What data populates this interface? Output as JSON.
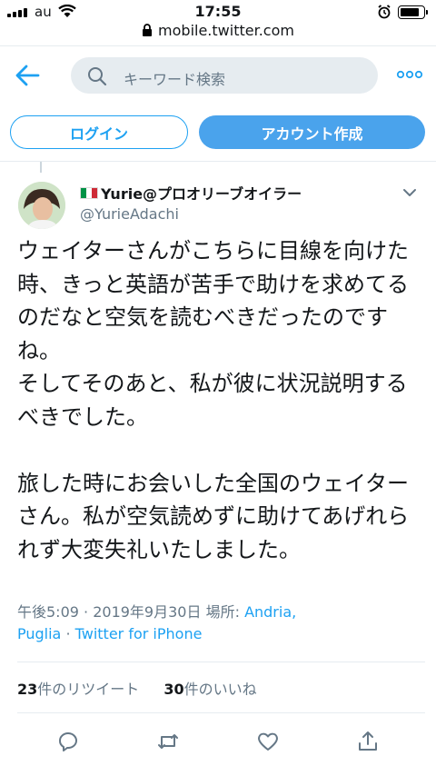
{
  "status_bar": {
    "carrier": "au",
    "time": "17:55",
    "battery_level": 0.85
  },
  "browser": {
    "url": "mobile.twitter.com"
  },
  "header": {
    "search_placeholder": "キーワード検索"
  },
  "auth": {
    "login_label": "ログイン",
    "signup_label": "アカウント作成"
  },
  "tweet": {
    "display_name": "Yurie@プロオリーブオイラー",
    "handle": "@YurieAdachi",
    "text": "ウェイターさんがこちらに目線を向けた時、きっと英語が苦手で助けを求めてるのだなと空気を読むべきだったのですね。\nそしてそのあと、私が彼に状況説明するべきでした。\n\n旅した時にお会いした全国のウェイターさん。私が空気読めずに助けてあげれられず大変失礼いたしました。",
    "time": "午後5:09",
    "date": "2019年9月30日",
    "location_label": "場所:",
    "location_line1": "Andria,",
    "location_line2": "Puglia",
    "source": "Twitter for iPhone"
  },
  "stats": {
    "retweets_count": "23",
    "retweets_label": "件のリツイート",
    "likes_count": "30",
    "likes_label": "件のいいね"
  },
  "icons": {
    "flag": "italy-flag-icon",
    "actions": [
      "reply-icon",
      "retweet-icon",
      "like-icon",
      "share-icon"
    ]
  },
  "colors": {
    "accent": "#1da1f2",
    "signup_bg": "#4aa3ec",
    "muted": "#657786",
    "search_bg": "#e6ecf0"
  }
}
